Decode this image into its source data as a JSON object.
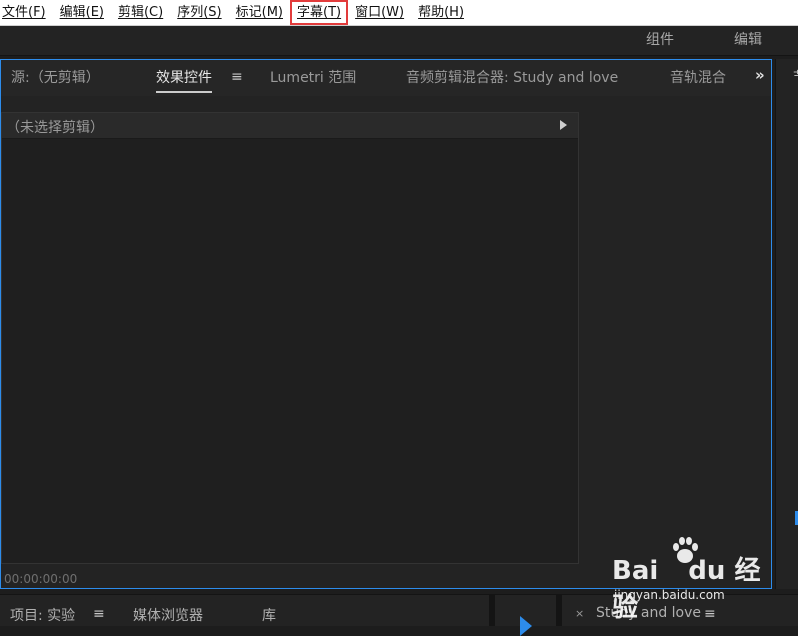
{
  "menubar": {
    "items": [
      {
        "label": "文件(F)"
      },
      {
        "label": "编辑(E)"
      },
      {
        "label": "剪辑(C)"
      },
      {
        "label": "序列(S)"
      },
      {
        "label": "标记(M)"
      },
      {
        "label": "字幕(T)"
      },
      {
        "label": "窗口(W)"
      },
      {
        "label": "帮助(H)"
      }
    ],
    "highlight_color": "#e23b3b"
  },
  "workspace": {
    "tabs": [
      "组件",
      "编辑"
    ]
  },
  "panel": {
    "tabs": [
      {
        "label": "源:（无剪辑）"
      },
      {
        "label": "效果控件",
        "active": true
      },
      {
        "label": "Lumetri 范围"
      },
      {
        "label": "音频剪辑混合器: Study and love"
      },
      {
        "label": "音轨混合"
      }
    ],
    "menu_icon": "hamburger-icon",
    "more_icon": "double-chevron-right-icon",
    "effect_controls": {
      "no_clip_text": "（未选择剪辑）",
      "timecode": "00:00:00:00"
    },
    "accent_color": "#2d8ceb"
  },
  "right_strip": {
    "tab_char": "节"
  },
  "bottom": {
    "tabs": [
      {
        "label": "项目: 实验"
      },
      {
        "label": "媒体浏览器"
      },
      {
        "label": "库"
      }
    ],
    "sequence_tab": "Study and love"
  },
  "watermark": {
    "brand_a": "Bai",
    "brand_b": "du",
    "suffix": "经验",
    "domain": "jingyan.baidu.com"
  }
}
